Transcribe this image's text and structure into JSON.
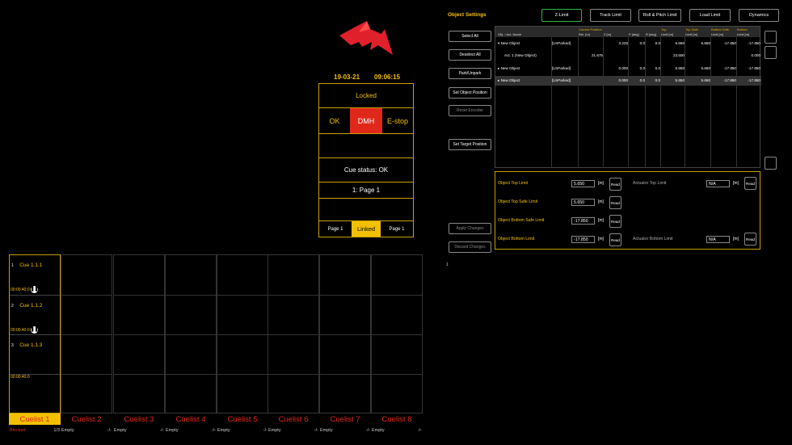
{
  "header": {
    "date": "19-03-21",
    "time": "09:06:15"
  },
  "status": {
    "locked": "Locked",
    "ok": "OK",
    "dmh": "DMH",
    "estop": "E-stop",
    "cue_status": "Cue status: OK",
    "page": "1: Page 1",
    "page_left": "Page 1",
    "linked": "Linked",
    "page_right": "Page 1"
  },
  "cuelists": {
    "cues": [
      {
        "num": "1",
        "name": "Cue 1.1.1",
        "time": "00:00:40:0",
        "hold": true
      },
      {
        "num": "2",
        "name": "Cue 1.1.2",
        "time": "00:00:40:0",
        "hold": true
      },
      {
        "num": "3",
        "name": "Cue 1.1.3",
        "time": "00:00:40:0",
        "hold": false
      }
    ],
    "tabs": [
      "Cuelist 1",
      "Cuelist 2",
      "Cuelist 3",
      "Cuelist 4",
      "Cuelist 5",
      "Cuelist 6",
      "Cuelist 7",
      "Cuelist 8"
    ],
    "footers": [
      {
        "left": "Blocked",
        "right": "1/3"
      },
      {
        "left": "Empty",
        "right": "-/-"
      },
      {
        "left": "Empty",
        "right": "-/-"
      },
      {
        "left": "Empty",
        "right": "-/-"
      },
      {
        "left": "Empty",
        "right": "-/-"
      },
      {
        "left": "Empty",
        "right": "-/-"
      },
      {
        "left": "Empty",
        "right": "-/-"
      },
      {
        "left": "Empty",
        "right": "-/-"
      }
    ]
  },
  "object_settings": {
    "title": "Object Settings",
    "top_tabs": [
      "Z-Limit",
      "Track Limit",
      "Roll & Pitch Limit",
      "Load Limit",
      "Dynamics"
    ],
    "left_buttons": [
      "Select All",
      "Deselect All",
      "Park/Unpark",
      "Set Object Position",
      "Reset Encoder",
      "Set Target Position"
    ],
    "apply": "Apply Changes",
    "discard": "Discard Changes",
    "page_indicator": "1"
  },
  "table": {
    "group_headers": [
      "Current Position",
      "Top",
      "Top Safe",
      "Bottom Safe",
      "Bottom"
    ],
    "headers": [
      "Obj. / Act. Name",
      "",
      "Rel. [m]",
      "Z [m]",
      "P [deg]",
      "R [deg]",
      "Limit [m]",
      "Limit [m]",
      "Limit [m]",
      "Limit [m]"
    ],
    "rows": [
      {
        "name": "▾ New Object",
        "park": "[UnParked]",
        "rel": "",
        "z": "3.225",
        "p": "0.0",
        "r": "0.0",
        "top": "5.650",
        "topsafe": "5.650",
        "botsafe": "-17.850",
        "bot": "-17.850"
      },
      {
        "name": "Act. 1 (New Object)",
        "park": "",
        "rel": "21.675",
        "z": "",
        "p": "",
        "r": "",
        "top": "23.500",
        "topsafe": "",
        "botsafe": "",
        "bot": "0.000"
      },
      {
        "name": "▸ New Object",
        "park": "[UnParked]",
        "rel": "",
        "z": "0.000",
        "p": "0.0",
        "r": "0.0",
        "top": "5.650",
        "topsafe": "5.650",
        "botsafe": "-17.850",
        "bot": "-17.850"
      },
      {
        "name": "▸ New Object",
        "park": "[UnParked]",
        "rel": "",
        "z": "0.000",
        "p": "0.0",
        "r": "0.0",
        "top": "5.650",
        "topsafe": "5.650",
        "botsafe": "-17.850",
        "bot": "-17.850"
      }
    ]
  },
  "limits": {
    "top_label": "Object Top Limit",
    "top_value": "5.650",
    "topsafe_label": "Object Top Safe Limit",
    "topsafe_value": "5.650",
    "botsafe_label": "Object Bottom Safe Limit",
    "botsafe_value": "-17.850",
    "bot_label": "Object Bottom Limit",
    "bot_value": "-17.850",
    "act_top_label": "Actuator Top Limit",
    "act_top_value": "N/A",
    "act_bot_label": "Actuator Bottom Limit",
    "act_bot_value": "N/A",
    "unit": "[m]",
    "read": "Read"
  },
  "colors": {
    "accent": "#f3c000",
    "dmh": "#e0281a",
    "linked": "#f3c000",
    "tab_red": "#e0281a"
  }
}
